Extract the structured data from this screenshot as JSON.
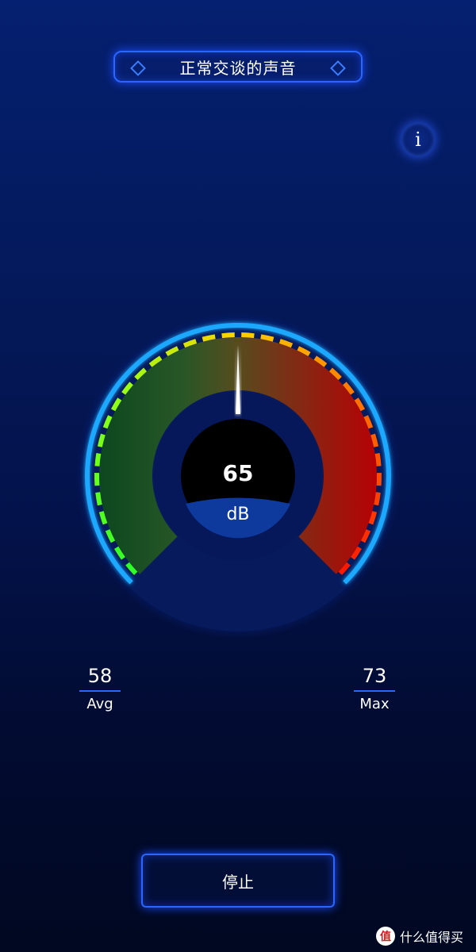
{
  "header": {
    "title": "正常交谈的声音",
    "info_label": "i"
  },
  "gauge": {
    "value": "65",
    "unit": "dB",
    "level": 65,
    "avg": 58,
    "max": 73
  },
  "stats": {
    "avg_value": "58",
    "avg_label": "Avg",
    "max_value": "73",
    "max_label": "Max"
  },
  "actions": {
    "stop_label": "停止"
  },
  "watermark": {
    "logo_text": "值",
    "text": "什么值得买"
  },
  "colors": {
    "accent": "#2a66ff",
    "ring": "#1fa8ff"
  }
}
